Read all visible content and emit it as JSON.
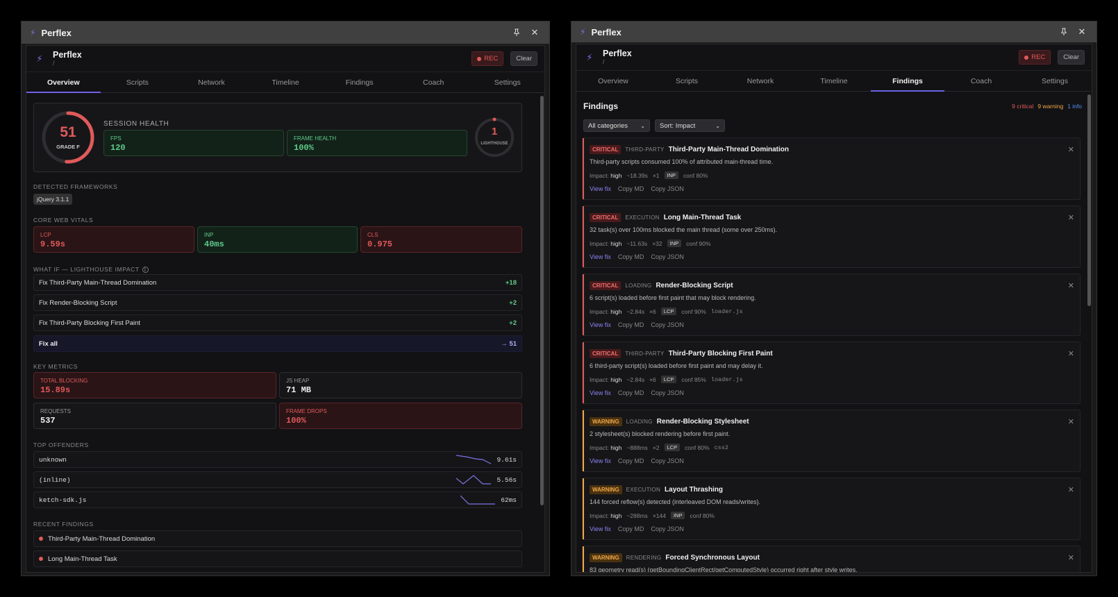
{
  "window_title": "Perflex",
  "app": {
    "name": "Perflex",
    "path": "/",
    "rec_label": "REC",
    "clear_label": "Clear"
  },
  "tabs": [
    "Overview",
    "Scripts",
    "Network",
    "Timeline",
    "Findings",
    "Coach",
    "Settings"
  ],
  "overview": {
    "score": "51",
    "grade": "GRADE F",
    "session_health_label": "SESSION HEALTH",
    "fps": {
      "label": "FPS",
      "value": "120"
    },
    "frame_health": {
      "label": "FRAME HEALTH",
      "value": "100%"
    },
    "lighthouse": {
      "value": "1",
      "label": "LIGHTHOUSE"
    },
    "frameworks_label": "DETECTED FRAMEWORKS",
    "frameworks": [
      "jQuery 3.1.1"
    ],
    "cwv_label": "CORE WEB VITALS",
    "cwv": [
      {
        "label": "LCP",
        "value": "9.59s",
        "status": "bad"
      },
      {
        "label": "INP",
        "value": "40ms",
        "status": "good"
      },
      {
        "label": "CLS",
        "value": "0.975",
        "status": "bad"
      }
    ],
    "whatif_label": "WHAT IF — LIGHTHOUSE IMPACT",
    "whatif": [
      {
        "label": "Fix Third-Party Main-Thread Domination",
        "delta": "+18"
      },
      {
        "label": "Fix Render-Blocking Script",
        "delta": "+2"
      },
      {
        "label": "Fix Third-Party Blocking First Paint",
        "delta": "+2"
      }
    ],
    "fix_all": {
      "label": "Fix all",
      "value": "→ 51"
    },
    "key_metrics_label": "KEY METRICS",
    "key_metrics": [
      {
        "label": "TOTAL BLOCKING",
        "value": "15.89s",
        "status": "bad"
      },
      {
        "label": "JS HEAP",
        "value": "71 MB",
        "status": "neutral"
      },
      {
        "label": "REQUESTS",
        "value": "537",
        "status": "neutral"
      },
      {
        "label": "FRAME DROPS",
        "value": "100%",
        "status": "bad"
      }
    ],
    "offenders_label": "TOP OFFENDERS",
    "offenders": [
      {
        "name": "unknown",
        "value": "9.61s"
      },
      {
        "name": "(inline)",
        "value": "5.56s"
      },
      {
        "name": "ketch-sdk.js",
        "value": "62ms"
      }
    ],
    "recent_label": "RECENT FINDINGS",
    "recent": [
      "Third-Party Main-Thread Domination",
      "Long Main-Thread Task"
    ],
    "colors": {
      "bad": "#e05a5a",
      "good": "#5ec98a",
      "accent": "#6d63e6"
    }
  },
  "findings": {
    "title": "Findings",
    "counts": {
      "critical": "9 critical",
      "warning": "9 warning",
      "info": "1 info"
    },
    "filter_category": "All categories",
    "filter_sort": "Sort: Impact",
    "actions": {
      "view": "View fix",
      "md": "Copy MD",
      "json": "Copy JSON"
    },
    "impact_label": "Impact:",
    "items": [
      {
        "severity": "CRITICAL",
        "category": "THIRD-PARTY",
        "title": "Third-Party Main-Thread Domination",
        "desc": "Third-party scripts consumed 100% of attributed main-thread time.",
        "impact": "high",
        "time": "~18.39s",
        "count": "×1",
        "metric": "INP",
        "conf": "conf 80%",
        "file": ""
      },
      {
        "severity": "CRITICAL",
        "category": "EXECUTION",
        "title": "Long Main-Thread Task",
        "desc": "32 task(s) over 100ms blocked the main thread (some over 250ms).",
        "impact": "high",
        "time": "~11.63s",
        "count": "×32",
        "metric": "INP",
        "conf": "conf 90%",
        "file": ""
      },
      {
        "severity": "CRITICAL",
        "category": "LOADING",
        "title": "Render-Blocking Script",
        "desc": "6 script(s) loaded before first paint that may block rendering.",
        "impact": "high",
        "time": "~2.84s",
        "count": "×6",
        "metric": "LCP",
        "conf": "conf 90%",
        "file": "loader.js"
      },
      {
        "severity": "CRITICAL",
        "category": "THIRD-PARTY",
        "title": "Third-Party Blocking First Paint",
        "desc": "6 third-party script(s) loaded before first paint and may delay it.",
        "impact": "high",
        "time": "~2.84s",
        "count": "×6",
        "metric": "LCP",
        "conf": "conf 85%",
        "file": "loader.js"
      },
      {
        "severity": "WARNING",
        "category": "LOADING",
        "title": "Render-Blocking Stylesheet",
        "desc": "2 stylesheet(s) blocked rendering before first paint.",
        "impact": "high",
        "time": "~888ms",
        "count": "×2",
        "metric": "LCP",
        "conf": "conf 80%",
        "file": "css2"
      },
      {
        "severity": "WARNING",
        "category": "EXECUTION",
        "title": "Layout Thrashing",
        "desc": "144 forced reflow(s) detected (interleaved DOM reads/writes).",
        "impact": "high",
        "time": "~288ms",
        "count": "×144",
        "metric": "INP",
        "conf": "conf 80%",
        "file": ""
      },
      {
        "severity": "WARNING",
        "category": "RENDERING",
        "title": "Forced Synchronous Layout",
        "desc": "83 geometry read(s) (getBoundingClientRect/getComputedStyle) occurred right after style writes.",
        "impact": "",
        "time": "",
        "count": "",
        "metric": "",
        "conf": "",
        "file": ""
      }
    ]
  }
}
